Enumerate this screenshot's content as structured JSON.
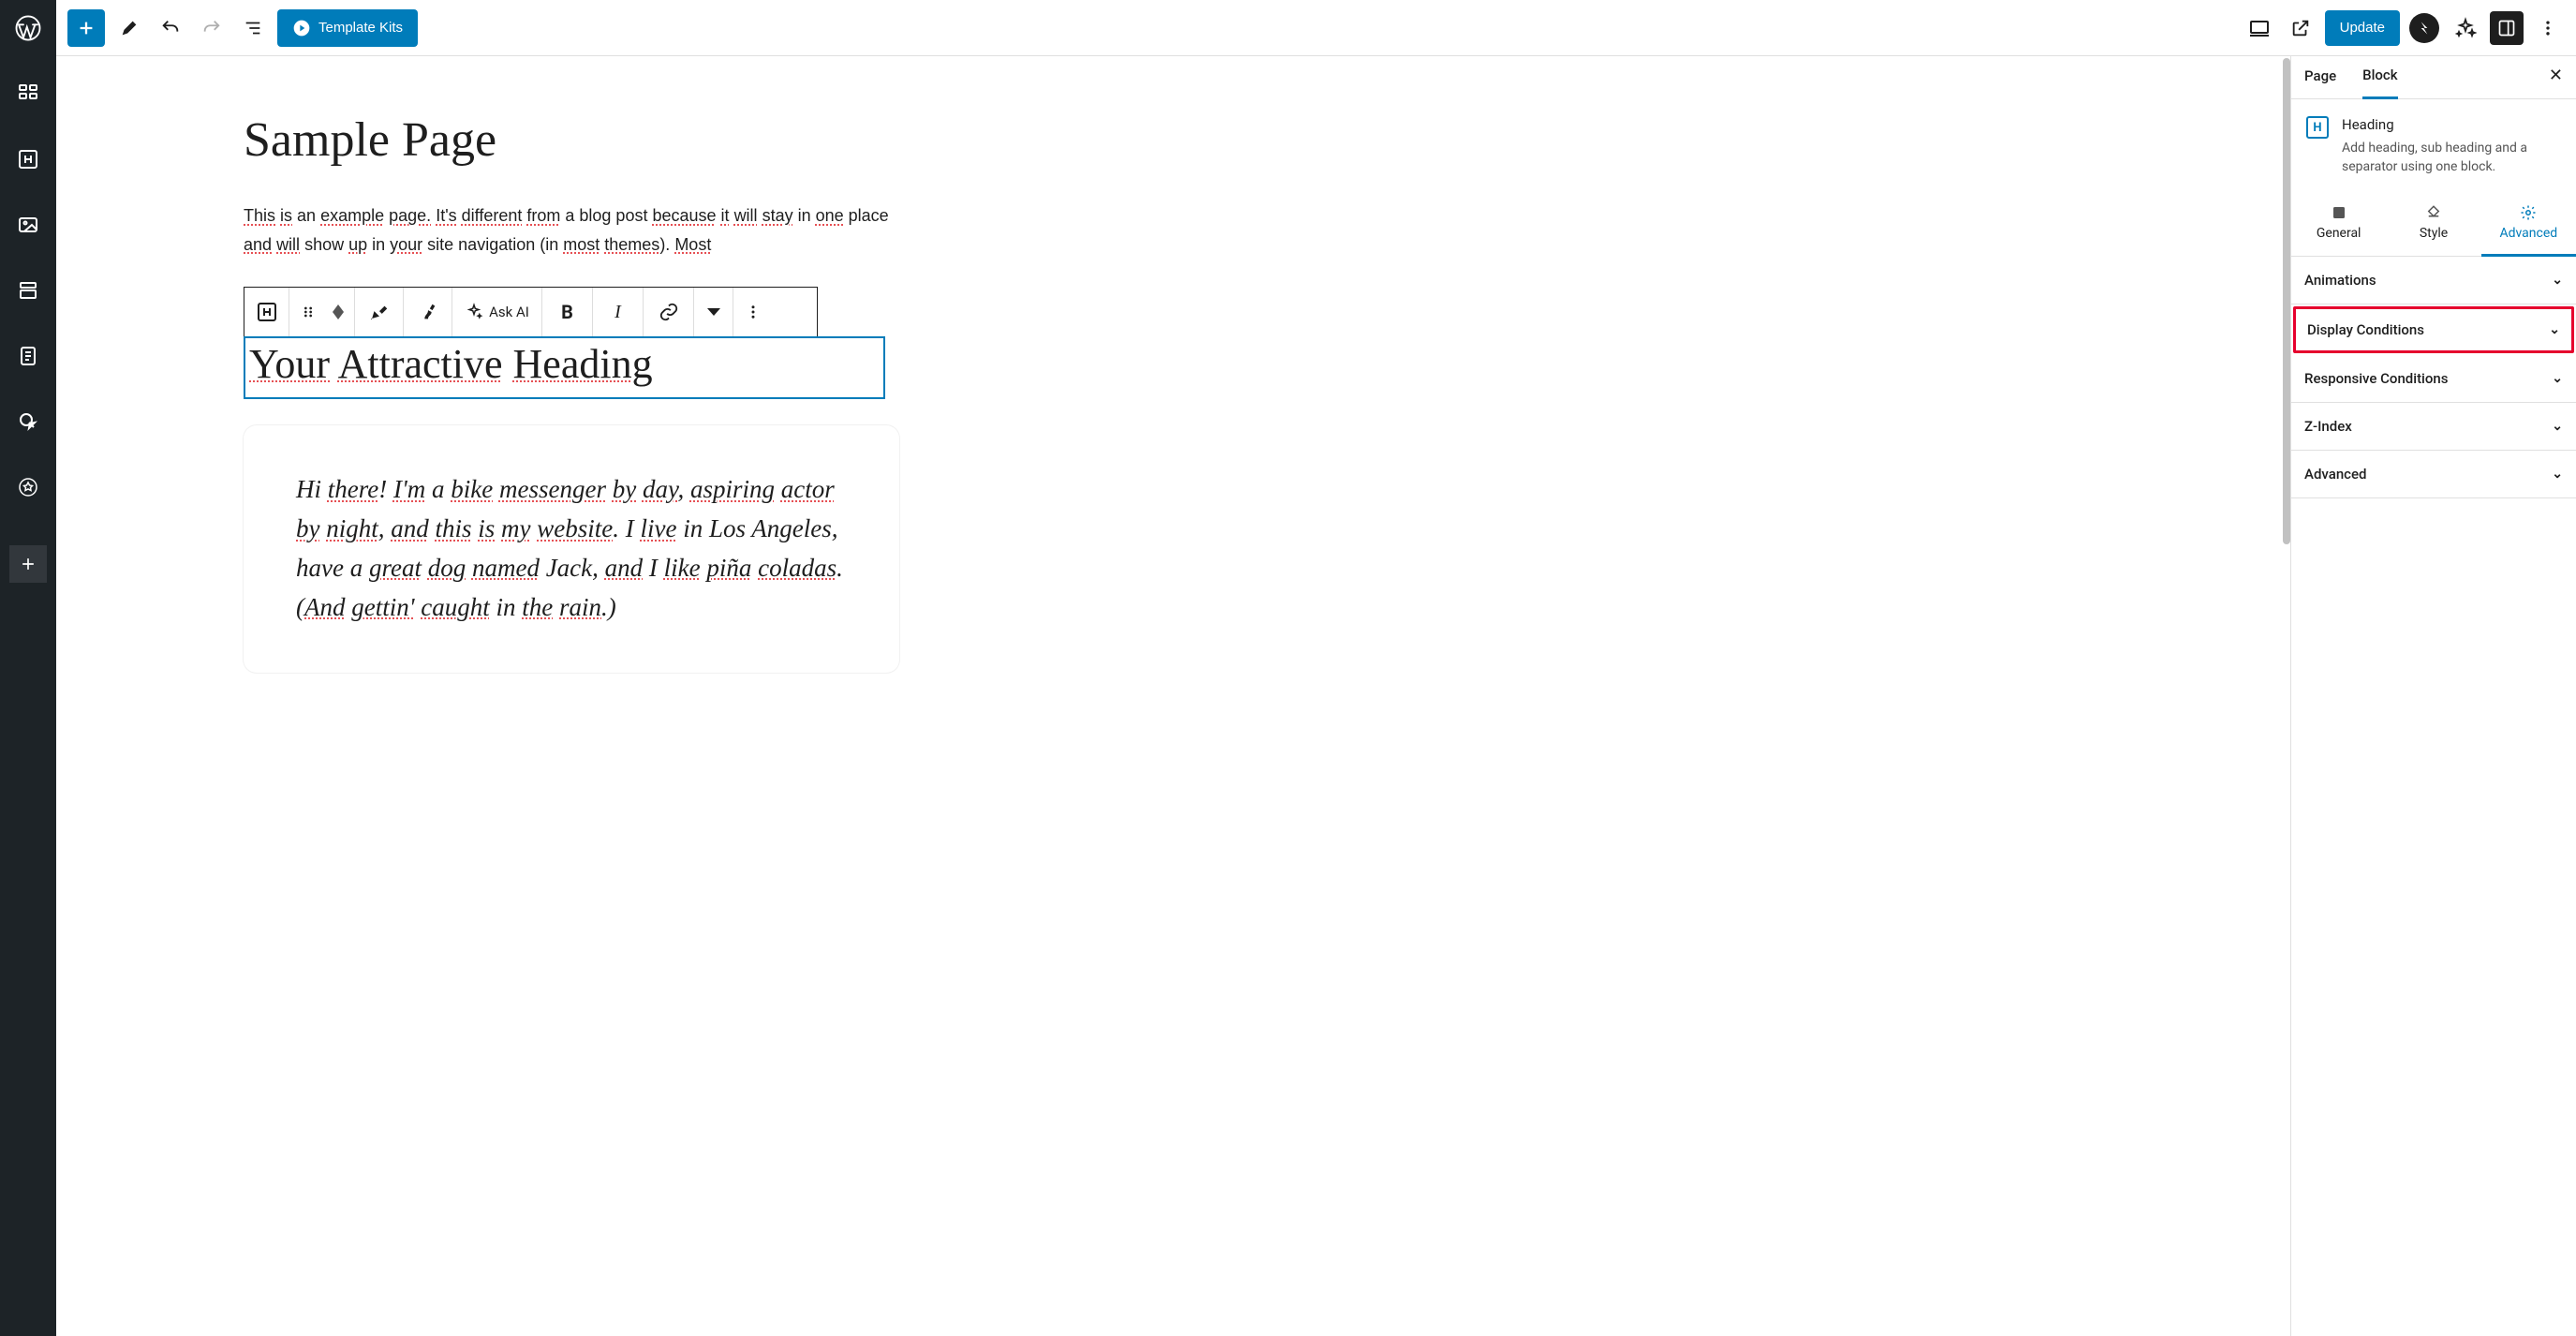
{
  "topbar": {
    "template_kits": "Template Kits",
    "update": "Update"
  },
  "canvas": {
    "title": "Sample Page",
    "intro_html": "This is an example page. It's different from a blog post because it will stay in one place and will show up in your site navigation (in most themes). Most",
    "heading_text": "Your Attractive Heading",
    "ask_ai": "Ask AI",
    "quote": "Hi there! I'm a bike messenger by day, aspiring actor by night, and this is my website. I live in Los Angeles, have a great dog named Jack, and I like piña coladas. (And gettin' caught in the rain.)"
  },
  "settings": {
    "tabs": {
      "page": "Page",
      "block": "Block"
    },
    "block_name": "Heading",
    "block_desc": "Add heading, sub heading and a separator using one block.",
    "subtabs": {
      "general": "General",
      "style": "Style",
      "advanced": "Advanced"
    },
    "panels": {
      "animations": "Animations",
      "display_conditions": "Display Conditions",
      "responsive": "Responsive Conditions",
      "zindex": "Z-Index",
      "advanced": "Advanced"
    }
  }
}
